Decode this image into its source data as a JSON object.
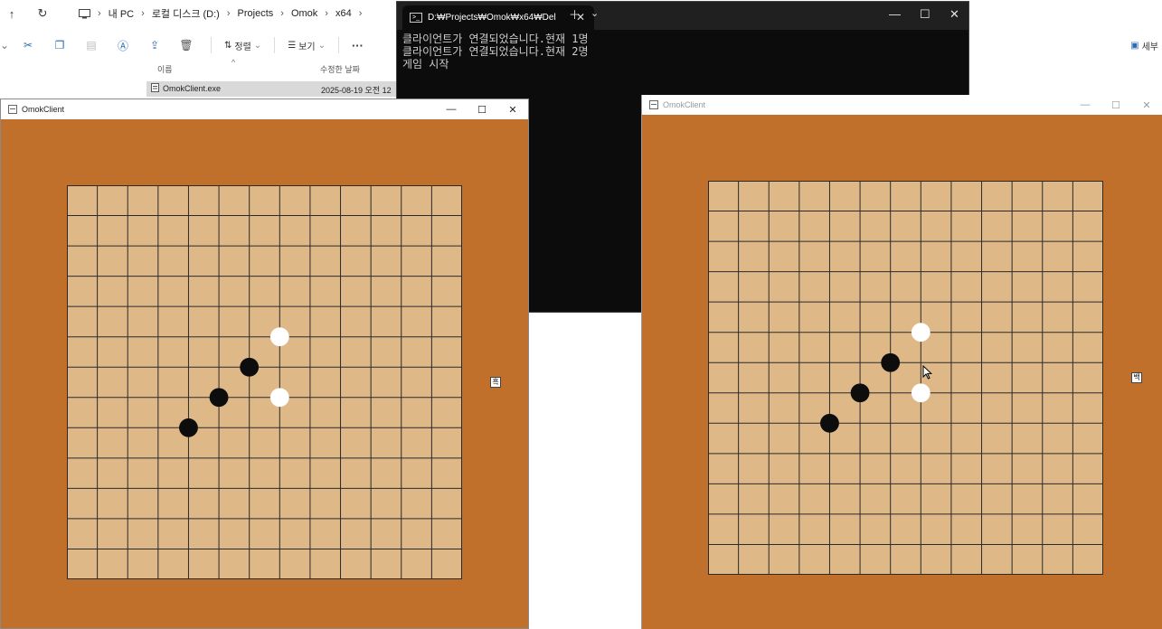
{
  "explorer": {
    "breadcrumbs": [
      "내 PC",
      "로컬 디스크 (D:)",
      "Projects",
      "Omok",
      "x64"
    ],
    "toolbar": {
      "sort_label": "정렬",
      "view_label": "보기",
      "more_label": "···",
      "details_label": "세부"
    },
    "columns": {
      "name": "이름",
      "modified": "수정한 날짜"
    },
    "file": {
      "name": "OmokClient.exe",
      "modified": "2025-08-19 오전 12"
    }
  },
  "console": {
    "tab_title": "D:₩Projects₩Omok₩x64₩Del",
    "lines": [
      "클라이언트가 연결되었습니다.현재 1명",
      "클라이언트가 연결되었습니다.현재 2명",
      "게임 시작"
    ]
  },
  "omok_left": {
    "title": "OmokClient",
    "side_label": "흑",
    "grid_cells": 13,
    "stones": [
      {
        "col": 7,
        "row": 5,
        "color": "white"
      },
      {
        "col": 6,
        "row": 6,
        "color": "black"
      },
      {
        "col": 5,
        "row": 7,
        "color": "black"
      },
      {
        "col": 7,
        "row": 7,
        "color": "white"
      },
      {
        "col": 4,
        "row": 8,
        "color": "black"
      }
    ]
  },
  "omok_right": {
    "title": "OmokClient",
    "side_label": "백",
    "grid_cells": 13,
    "stones": [
      {
        "col": 7,
        "row": 5,
        "color": "white"
      },
      {
        "col": 6,
        "row": 6,
        "color": "black"
      },
      {
        "col": 5,
        "row": 7,
        "color": "black"
      },
      {
        "col": 7,
        "row": 7,
        "color": "white"
      },
      {
        "col": 4,
        "row": 8,
        "color": "black"
      }
    ]
  },
  "colors": {
    "board": "#deb887",
    "frame": "#c0702a",
    "grid": "#2a2a2a",
    "console_bg": "#0c0c0c"
  }
}
